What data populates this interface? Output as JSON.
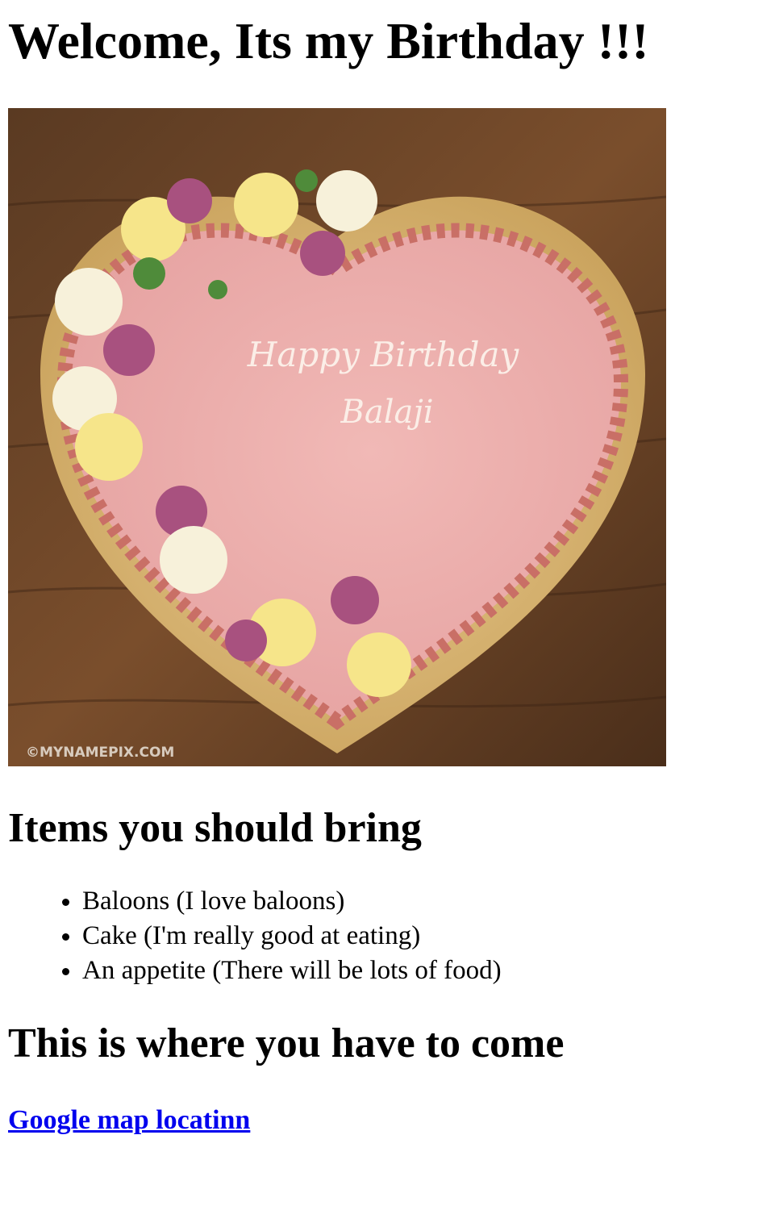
{
  "page": {
    "title": "Welcome, Its my Birthday !!!"
  },
  "cake_image": {
    "description_icon": "birthday-cake-image",
    "cake_text_line1": "Happy Birthday",
    "cake_text_line2": "Balaji",
    "watermark": "©MYNAMEPIX.COM"
  },
  "items_section": {
    "heading": "Items you should bring",
    "items": [
      "Baloons (I love baloons)",
      "Cake (I'm really good at eating)",
      "An appetite (There will be lots of food)"
    ]
  },
  "location_section": {
    "heading": "This is where you have to come",
    "link_label": "Google map locatinn"
  },
  "colors": {
    "link": "#0000ee",
    "text": "#000000",
    "background": "#ffffff"
  }
}
